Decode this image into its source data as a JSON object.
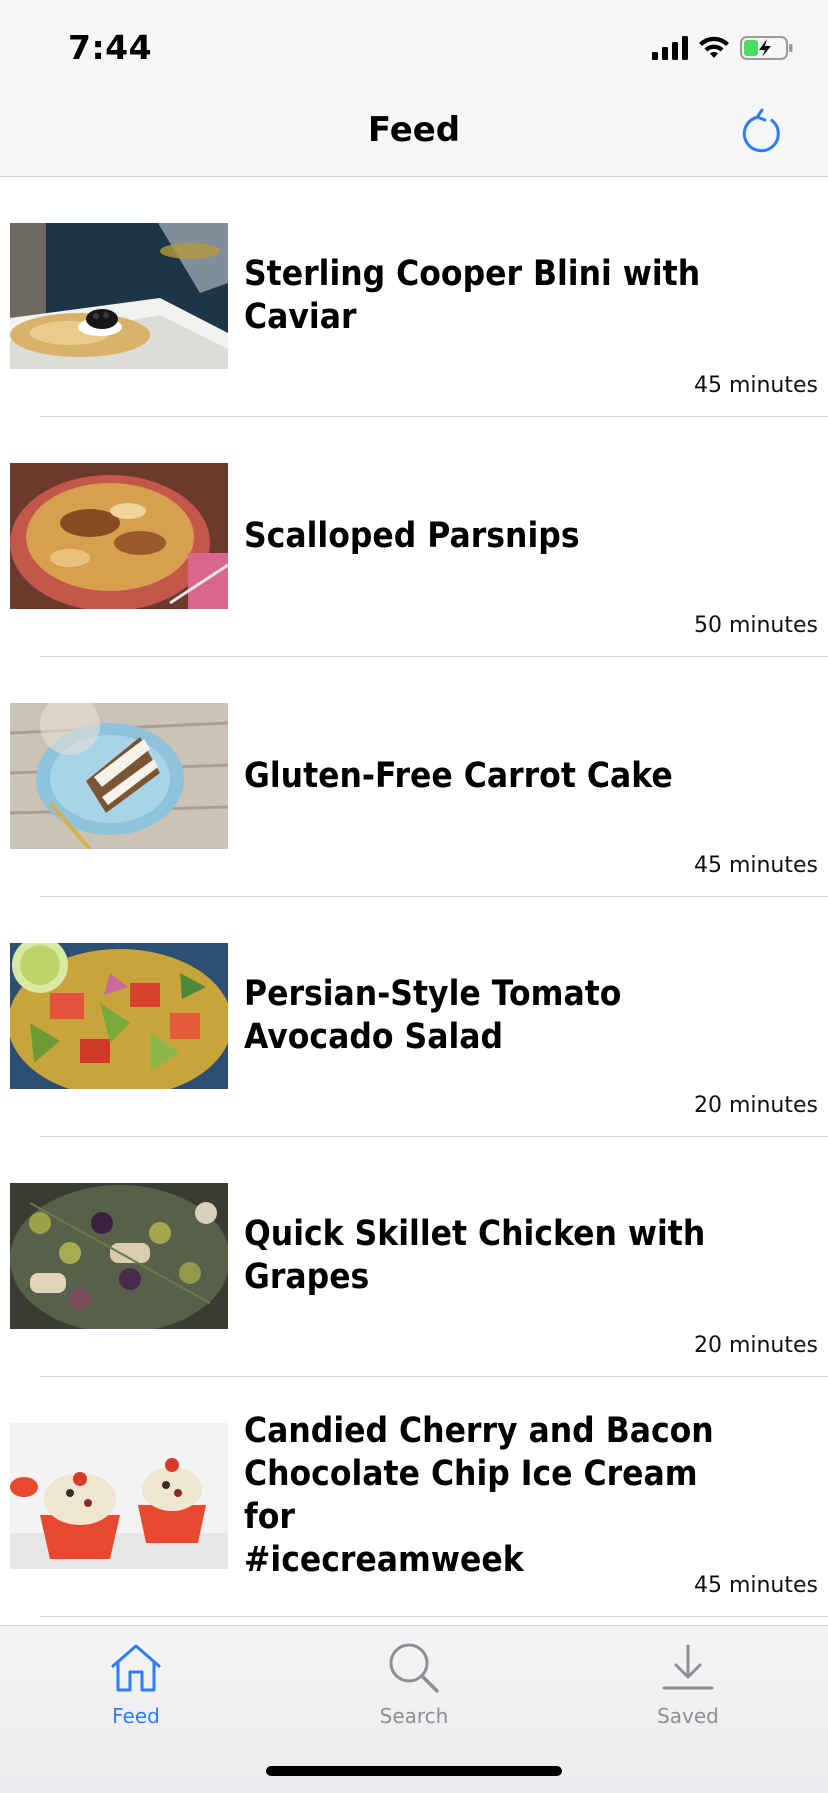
{
  "status_bar": {
    "time": "7:44",
    "icons": [
      "signal-icon",
      "wifi-icon",
      "battery-charging-icon"
    ]
  },
  "nav": {
    "title": "Feed",
    "refresh_icon": "refresh-icon"
  },
  "colors": {
    "accent": "#2f7cf6",
    "inactive": "#8e8e93",
    "bar_background": "#f6f6f6"
  },
  "feed": {
    "items": [
      {
        "title_lines": [
          "Sterling Cooper Blini with Caviar"
        ],
        "duration": "45 minutes"
      },
      {
        "title_lines": [
          "Scalloped Parsnips"
        ],
        "duration": "50 minutes"
      },
      {
        "title_lines": [
          "Gluten-Free Carrot Cake"
        ],
        "duration": "45 minutes"
      },
      {
        "title_lines": [
          "Persian-Style Tomato",
          "Avocado Salad"
        ],
        "duration": "20 minutes"
      },
      {
        "title_lines": [
          "Quick Skillet Chicken with Grapes"
        ],
        "duration": "20 minutes"
      },
      {
        "title_lines": [
          "Candied Cherry and Bacon",
          "Chocolate Chip Ice Cream for",
          "#icecreamweek"
        ],
        "duration": "45 minutes"
      }
    ]
  },
  "tabs": [
    {
      "label": "Feed",
      "icon": "home-icon",
      "active": true
    },
    {
      "label": "Search",
      "icon": "search-icon",
      "active": false
    },
    {
      "label": "Saved",
      "icon": "download-icon",
      "active": false
    }
  ]
}
